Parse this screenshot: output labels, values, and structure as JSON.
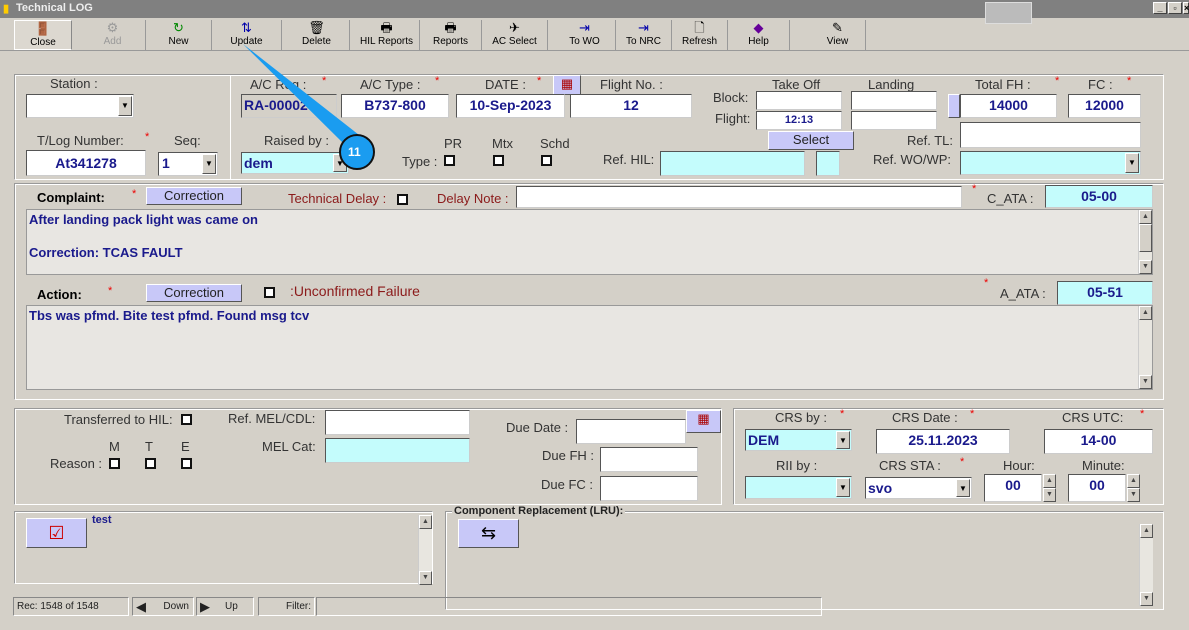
{
  "window": {
    "title": "Technical LOG"
  },
  "toolbar": [
    {
      "label": "Close",
      "icon": "exit-door-icon"
    },
    {
      "label": "Add",
      "icon": "add-icon",
      "disabled": true
    },
    {
      "label": "New",
      "icon": "new-icon"
    },
    {
      "label": "Update",
      "icon": "update-icon"
    },
    {
      "label": "Delete",
      "icon": "trash-icon"
    },
    {
      "label": "HIL Reports",
      "icon": "printer-icon"
    },
    {
      "label": "Reports",
      "icon": "printer-icon"
    },
    {
      "label": "AC Select",
      "icon": "airplane-icon"
    },
    {
      "label": "To WO",
      "icon": "export-icon"
    },
    {
      "label": "To NRC",
      "icon": "export-icon"
    },
    {
      "label": "Refresh",
      "icon": "page-icon"
    },
    {
      "label": "Help",
      "icon": "help-book-icon"
    },
    {
      "label": "View",
      "icon": "view-icon"
    }
  ],
  "header": {
    "station_label": "Station :",
    "station_value": "",
    "tlog_label": "T/Log Number:",
    "tlog_value": "At341278",
    "seq_label": "Seq:",
    "seq_value": "1",
    "acreg_label": "A/C Reg :",
    "acreg_value": "RA-00002",
    "actype_label": "A/C Type :",
    "actype_value": "B737-800",
    "date_label": "DATE :",
    "date_value": "10-Sep-2023",
    "flightno_label": "Flight No. :",
    "flightno_value": "12",
    "raisedby_label": "Raised by :",
    "raisedby_value": "dem",
    "type_label": "Type :",
    "pr_label": "PR",
    "mtx_label": "Mtx",
    "schd_label": "Schd",
    "takeoff_label": "Take Off",
    "landing_label": "Landing",
    "block_label": "Block:",
    "flight_label": "Flight:",
    "flight_takeoff": "12:13",
    "select_label": "Select",
    "refhil_label": "Ref. HIL:",
    "totalfh_label": "Total FH :",
    "totalfh_value": "14000",
    "fc_label": "FC :",
    "fc_value": "12000",
    "reftl_label": "Ref. TL:",
    "refwo_label": "Ref. WO/WP:"
  },
  "complaint": {
    "label": "Complaint:",
    "correction_label": "Correction",
    "tech_delay_label": "Technical Delay :",
    "delay_note_label": "Delay Note :",
    "cata_label": "C_ATA :",
    "cata_value": "05-00",
    "line1": "After landing pack light was came on",
    "line2": "Correction: TCAS FAULT"
  },
  "action": {
    "label": "Action:",
    "correction_label": "Correction",
    "unconfirmed_label": ":Unconfirmed Failure",
    "aata_label": "A_ATA :",
    "aata_value": "05-51",
    "text": "Tbs was pfmd. Bite test pfmd. Found msg tcv"
  },
  "deferral": {
    "transferred_label": "Transferred to HIL:",
    "m": "M",
    "t": "T",
    "e": "E",
    "reason_label": "Reason :",
    "refmel_label": "Ref. MEL/CDL:",
    "melcat_label": "MEL Cat:",
    "duedate_label": "Due Date :",
    "duefh_label": "Due FH :",
    "duefc_label": "Due FC :"
  },
  "crs": {
    "crsby_label": "CRS by :",
    "crsby_value": "DEM",
    "crsdate_label": "CRS Date :",
    "crsdate_value": "25.11.2023",
    "crsutc_label": "CRS UTC:",
    "crsutc_value": "14-00",
    "rii_label": "RII by :",
    "crssta_label": "CRS STA :",
    "crssta_value": "svo",
    "hour_label": "Hour:",
    "hour_value": "00",
    "minute_label": "Minute:",
    "minute_value": "00"
  },
  "notes": {
    "text": "test"
  },
  "component": {
    "title": "Component Replacement (LRU):"
  },
  "statusbar": {
    "record": "Rec: 1548 of 1548",
    "down": "Down",
    "up": "Up",
    "filter": "Filter:"
  },
  "annotation": {
    "number": "11",
    "color": "#1a9cf0"
  }
}
